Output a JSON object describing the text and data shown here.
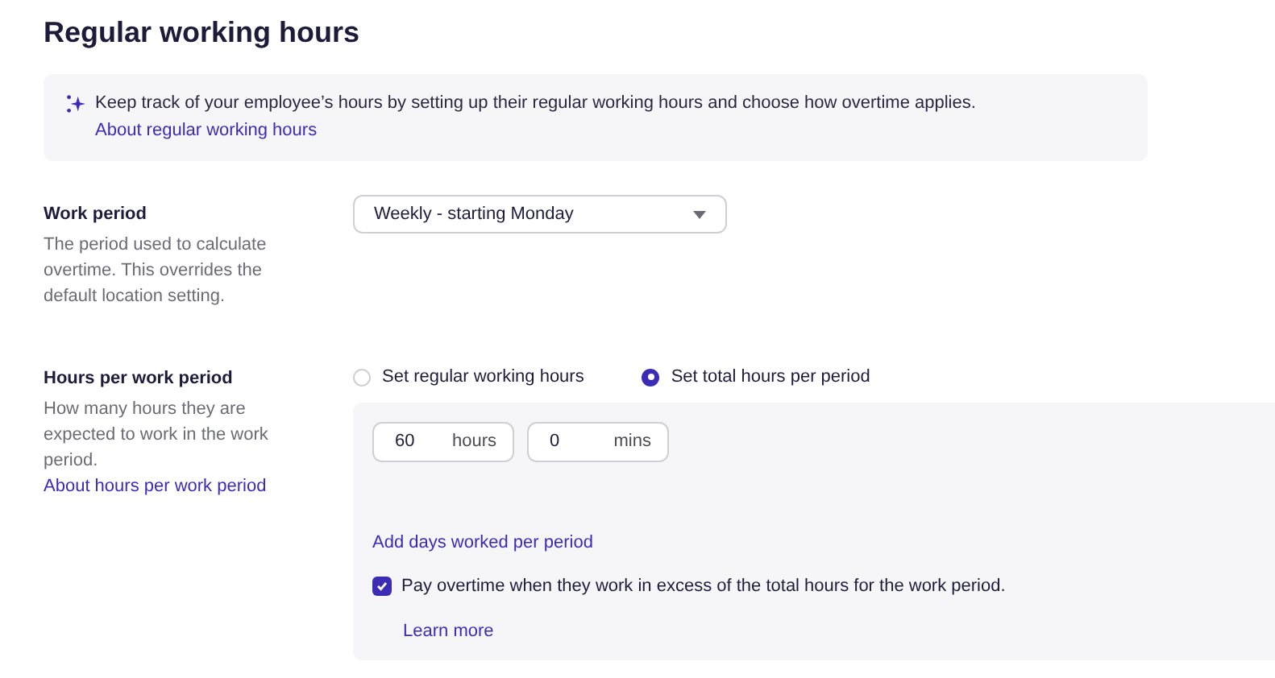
{
  "title": "Regular working hours",
  "info": {
    "text": "Keep track of your employee’s hours by setting up their regular working hours and choose how overtime applies.",
    "link": "About regular working hours"
  },
  "work_period": {
    "label": "Work period",
    "description": "The period used to calculate overtime. This overrides the default location setting.",
    "select": {
      "value": "Weekly - starting Monday"
    }
  },
  "hours_per_period": {
    "label": "Hours per work period",
    "description": "How many hours they are expected to work in the work period.",
    "link": "About hours per work period",
    "options": [
      {
        "label": "Set regular working hours",
        "selected": false
      },
      {
        "label": "Set total hours per period",
        "selected": true
      }
    ],
    "fields": [
      {
        "value": "60",
        "unit": "hours"
      },
      {
        "value": "0",
        "unit": "mins"
      }
    ],
    "add_link": "Add days worked per period",
    "overtime": {
      "label": "Pay overtime when they work in excess of the total hours for the work period.",
      "checked": true
    },
    "learn_more": "Learn more"
  }
}
